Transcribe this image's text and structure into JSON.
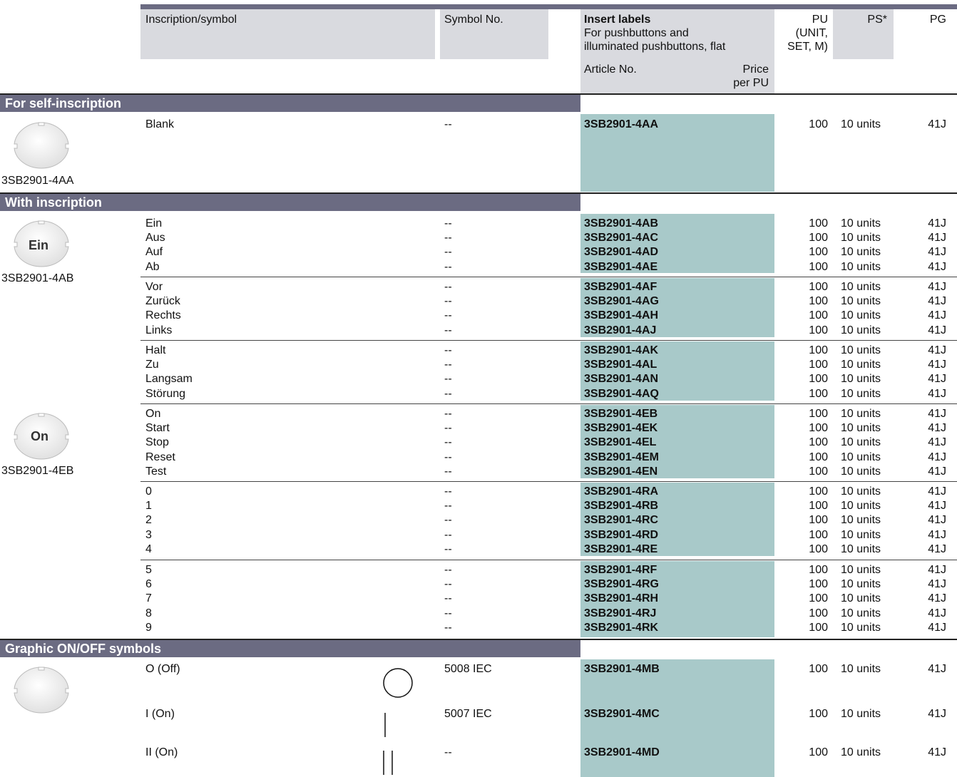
{
  "header": {
    "col_inscription": "Inscription/symbol",
    "col_symbol_no": "Symbol No.",
    "col_insert_title": "Insert labels",
    "col_insert_sub1": "For pushbuttons and",
    "col_insert_sub2": "illuminated pushbuttons, flat",
    "col_article": "Article No.",
    "col_price1": "Price",
    "col_price2": "per PU",
    "col_pu1": "PU",
    "col_pu2": "(UNIT,",
    "col_pu3": "SET, M)",
    "col_ps": "PS*",
    "col_pg": "PG"
  },
  "sections": {
    "self": "For self-inscription",
    "with": "With inscription",
    "graphic": "Graphic ON/OFF symbols"
  },
  "images": {
    "blank_caption": "3SB2901-4AA",
    "ein_caption": "3SB2901-4AB",
    "ein_label": "Ein",
    "on_caption": "3SB2901-4EB",
    "on_label": "On"
  },
  "self_rows": [
    {
      "ins": "Blank",
      "sym": "--",
      "art": "3SB2901-4AA",
      "pu": "100",
      "ps": "10 units",
      "pg": "41J"
    }
  ],
  "with_rows": [
    {
      "ins": "Ein",
      "sym": "--",
      "art": "3SB2901-4AB",
      "pu": "100",
      "ps": "10 units",
      "pg": "41J"
    },
    {
      "ins": "Aus",
      "sym": "--",
      "art": "3SB2901-4AC",
      "pu": "100",
      "ps": "10 units",
      "pg": "41J"
    },
    {
      "ins": "Auf",
      "sym": "--",
      "art": "3SB2901-4AD",
      "pu": "100",
      "ps": "10 units",
      "pg": "41J"
    },
    {
      "ins": "Ab",
      "sym": "--",
      "art": "3SB2901-4AE",
      "pu": "100",
      "ps": "10 units",
      "pg": "41J"
    },
    {
      "ins": "Vor",
      "sym": "--",
      "art": "3SB2901-4AF",
      "pu": "100",
      "ps": "10 units",
      "pg": "41J"
    },
    {
      "ins": "Zurück",
      "sym": "--",
      "art": "3SB2901-4AG",
      "pu": "100",
      "ps": "10 units",
      "pg": "41J"
    },
    {
      "ins": "Rechts",
      "sym": "--",
      "art": "3SB2901-4AH",
      "pu": "100",
      "ps": "10 units",
      "pg": "41J"
    },
    {
      "ins": "Links",
      "sym": "--",
      "art": "3SB2901-4AJ",
      "pu": "100",
      "ps": "10 units",
      "pg": "41J"
    },
    {
      "ins": "Halt",
      "sym": "--",
      "art": "3SB2901-4AK",
      "pu": "100",
      "ps": "10 units",
      "pg": "41J"
    },
    {
      "ins": "Zu",
      "sym": "--",
      "art": "3SB2901-4AL",
      "pu": "100",
      "ps": "10 units",
      "pg": "41J"
    },
    {
      "ins": "Langsam",
      "sym": "--",
      "art": "3SB2901-4AN",
      "pu": "100",
      "ps": "10 units",
      "pg": "41J"
    },
    {
      "ins": "Störung",
      "sym": "--",
      "art": "3SB2901-4AQ",
      "pu": "100",
      "ps": "10 units",
      "pg": "41J"
    },
    {
      "ins": "On",
      "sym": "--",
      "art": "3SB2901-4EB",
      "pu": "100",
      "ps": "10 units",
      "pg": "41J"
    },
    {
      "ins": "Start",
      "sym": "--",
      "art": "3SB2901-4EK",
      "pu": "100",
      "ps": "10 units",
      "pg": "41J"
    },
    {
      "ins": "Stop",
      "sym": "--",
      "art": "3SB2901-4EL",
      "pu": "100",
      "ps": "10 units",
      "pg": "41J"
    },
    {
      "ins": "Reset",
      "sym": "--",
      "art": "3SB2901-4EM",
      "pu": "100",
      "ps": "10 units",
      "pg": "41J"
    },
    {
      "ins": "Test",
      "sym": "--",
      "art": "3SB2901-4EN",
      "pu": "100",
      "ps": "10 units",
      "pg": "41J"
    },
    {
      "ins": "0",
      "sym": "--",
      "art": "3SB2901-4RA",
      "pu": "100",
      "ps": "10 units",
      "pg": "41J"
    },
    {
      "ins": "1",
      "sym": "--",
      "art": "3SB2901-4RB",
      "pu": "100",
      "ps": "10 units",
      "pg": "41J"
    },
    {
      "ins": "2",
      "sym": "--",
      "art": "3SB2901-4RC",
      "pu": "100",
      "ps": "10 units",
      "pg": "41J"
    },
    {
      "ins": "3",
      "sym": "--",
      "art": "3SB2901-4RD",
      "pu": "100",
      "ps": "10 units",
      "pg": "41J"
    },
    {
      "ins": "4",
      "sym": "--",
      "art": "3SB2901-4RE",
      "pu": "100",
      "ps": "10 units",
      "pg": "41J"
    },
    {
      "ins": "5",
      "sym": "--",
      "art": "3SB2901-4RF",
      "pu": "100",
      "ps": "10 units",
      "pg": "41J"
    },
    {
      "ins": "6",
      "sym": "--",
      "art": "3SB2901-4RG",
      "pu": "100",
      "ps": "10 units",
      "pg": "41J"
    },
    {
      "ins": "7",
      "sym": "--",
      "art": "3SB2901-4RH",
      "pu": "100",
      "ps": "10 units",
      "pg": "41J"
    },
    {
      "ins": "8",
      "sym": "--",
      "art": "3SB2901-4RJ",
      "pu": "100",
      "ps": "10 units",
      "pg": "41J"
    },
    {
      "ins": "9",
      "sym": "--",
      "art": "3SB2901-4RK",
      "pu": "100",
      "ps": "10 units",
      "pg": "41J"
    }
  ],
  "graphic_rows": [
    {
      "ins": "O (Off)",
      "sym": "5008 IEC",
      "art": "3SB2901-4MB",
      "pu": "100",
      "ps": "10 units",
      "pg": "41J",
      "icon": "circle-symbol-icon"
    },
    {
      "ins": "I (On)",
      "sym": "5007 IEC",
      "art": "3SB2901-4MC",
      "pu": "100",
      "ps": "10 units",
      "pg": "41J",
      "icon": "single-bar-symbol-icon"
    },
    {
      "ins": "II (On)",
      "sym": "--",
      "art": "3SB2901-4MD",
      "pu": "100",
      "ps": "10 units",
      "pg": "41J",
      "icon": "double-bar-symbol-icon"
    }
  ],
  "colors": {
    "section_bar": "#6b6b82",
    "article_highlight": "#a8c9c9",
    "header_bg": "#d9dadf"
  }
}
